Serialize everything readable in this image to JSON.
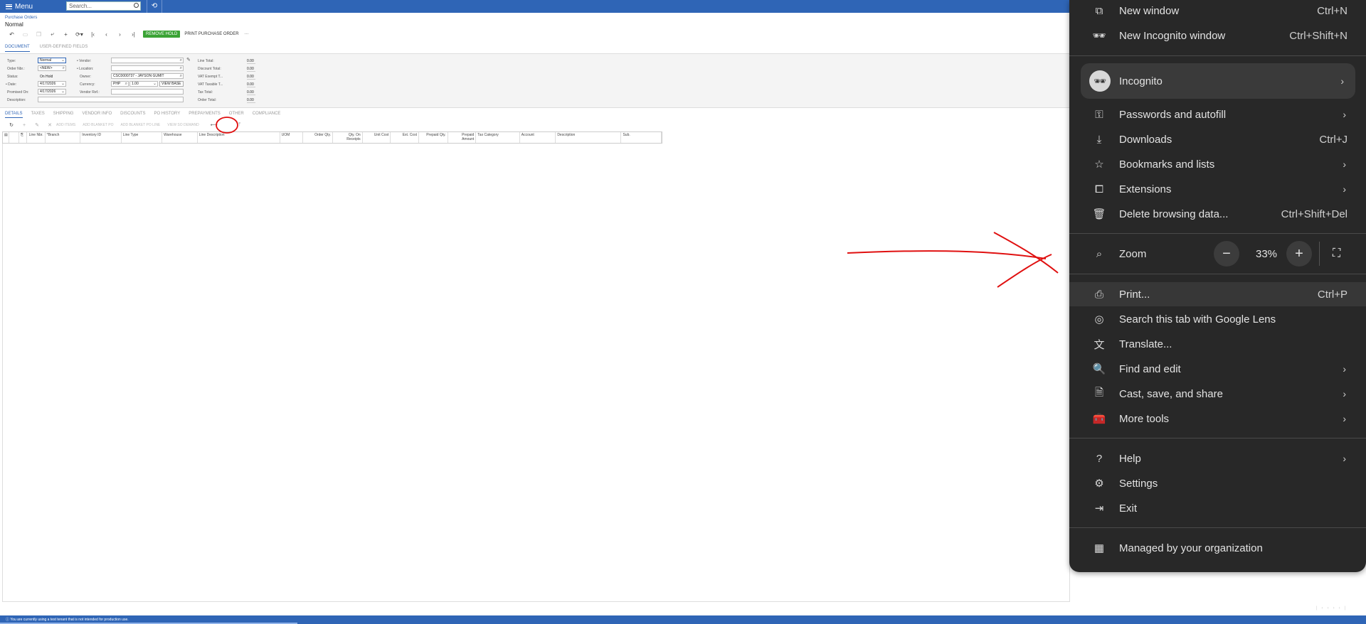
{
  "topbar": {
    "menu_label": "Menu",
    "search_placeholder": "Search..."
  },
  "header": {
    "breadcrumb": "Purchase Orders",
    "title": "Normal"
  },
  "toolbar": {
    "remove_hold": "REMOVE HOLD",
    "print_po": "PRINT PURCHASE ORDER",
    "more": "···"
  },
  "top_tabs": [
    "DOCUMENT",
    "USER-DEFINED FIELDS"
  ],
  "form": {
    "type_label": "Type:",
    "type_value": "Normal",
    "order_nbr_label": "Order Nbr.:",
    "order_nbr_value": "<NEW>",
    "status_label": "Status:",
    "status_value": "On Hold",
    "date_label": "• Date:",
    "date_value": "4/17/2026",
    "promised_label": "Promised On:",
    "promised_value": "4/17/2026",
    "description_label": "Description:",
    "vendor_label": "• Vendor:",
    "location_label": "• Location:",
    "owner_label": "Owner:",
    "owner_value": "CSC0000737 - JAYSON GUMIT",
    "currency_label": "Currency:",
    "currency_value": "PHP",
    "rate_value": "1.00",
    "view_base": "VIEW BASE",
    "vendor_ref_label": "Vendor Ref.:",
    "totals": [
      {
        "label": "Line Total:",
        "value": "0.00"
      },
      {
        "label": "Discount Total:",
        "value": "0.00"
      },
      {
        "label": "VAT Exempt T...",
        "value": "0.00"
      },
      {
        "label": "VAT Taxable T...",
        "value": "0.00"
      },
      {
        "label": "Tax Total:",
        "value": "0.00"
      },
      {
        "label": "Order Total:",
        "value": "0.00"
      }
    ]
  },
  "detail_tabs": [
    "DETAILS",
    "TAXES",
    "SHIPPING",
    "VENDOR INFO",
    "DISCOUNTS",
    "PO HISTORY",
    "PREPAYMENTS",
    "OTHER",
    "COMPLIANCE"
  ],
  "grid_toolbar": [
    "ADD ITEMS",
    "ADD BLANKET PO",
    "ADD BLANKET PO LINE",
    "VIEW SO DEMAND"
  ],
  "grid_columns": [
    "Line Nbr.",
    "*Branch",
    "Inventory ID",
    "Line Type",
    "Warehouse",
    "Line Description",
    "UOM",
    "Order Qty.",
    "Qty. On Receipts",
    "Unit Cost",
    "Ext. Cost",
    "Prepaid Qty.",
    "Prepaid Amount",
    "Tax Category",
    "Account",
    "Description",
    "Sub."
  ],
  "footer": {
    "text": "You are currently using a test tenant that is not intended for production use."
  },
  "chrome_menu": {
    "new_window": {
      "label": "New window",
      "shortcut": "Ctrl+N"
    },
    "new_incognito": {
      "label": "New Incognito window",
      "shortcut": "Ctrl+Shift+N"
    },
    "profile": {
      "label": "Incognito"
    },
    "passwords": {
      "label": "Passwords and autofill"
    },
    "downloads": {
      "label": "Downloads",
      "shortcut": "Ctrl+J"
    },
    "bookmarks": {
      "label": "Bookmarks and lists"
    },
    "extensions": {
      "label": "Extensions"
    },
    "delete_data": {
      "label": "Delete browsing data...",
      "shortcut": "Ctrl+Shift+Del"
    },
    "zoom": {
      "label": "Zoom",
      "value": "33%",
      "minus": "−",
      "plus": "+"
    },
    "print": {
      "label": "Print...",
      "shortcut": "Ctrl+P"
    },
    "lens": {
      "label": "Search this tab with Google Lens"
    },
    "translate": {
      "label": "Translate..."
    },
    "find_edit": {
      "label": "Find and edit"
    },
    "cast": {
      "label": "Cast, save, and share"
    },
    "more_tools": {
      "label": "More tools"
    },
    "help": {
      "label": "Help"
    },
    "settings": {
      "label": "Settings"
    },
    "exit": {
      "label": "Exit"
    },
    "managed": {
      "label": "Managed by your organization"
    }
  }
}
